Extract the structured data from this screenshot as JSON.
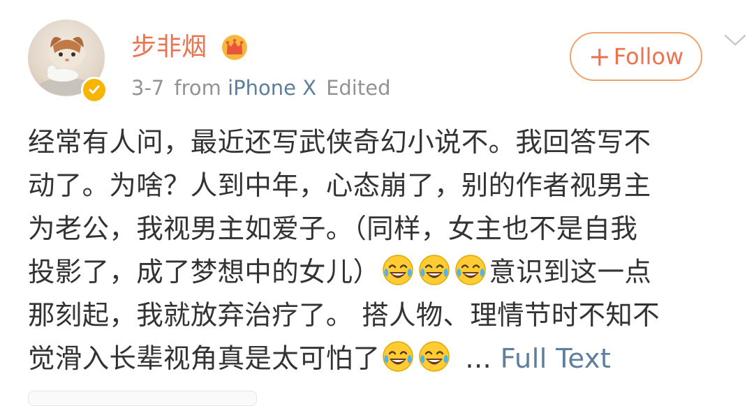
{
  "post": {
    "author": "步非烟",
    "author_badge_icon": "crown-icon",
    "verified_icon": "verified-badge-icon",
    "avatar_icon": "cat-avatar",
    "date": "3-7",
    "from_label": "from",
    "source": "iPhone X",
    "edited_label": "Edited",
    "follow_label": "Follow",
    "text_lines": [
      "经常有人问，最近还写武侠奇幻小说不。我回答写不",
      "动了。为啥？人到中年，心态崩了，别的作者视男主",
      "为老公，我视男主如爱子。（同样，女主也不是自我",
      "投影了，成了梦想中的女儿）",
      "意识到这一点",
      "那刻起，我就放弃治疗了。 搭人物、理情节时不知不",
      "觉滑入长辈视角真是太可怕了",
      "... ",
      "Full Text"
    ],
    "emoji_name": "laughing-crying-emoji"
  },
  "colors": {
    "username": "#eb7350",
    "link": "#5d7e9c",
    "meta": "#939393",
    "text": "#333333",
    "verified": "#f7b500"
  }
}
